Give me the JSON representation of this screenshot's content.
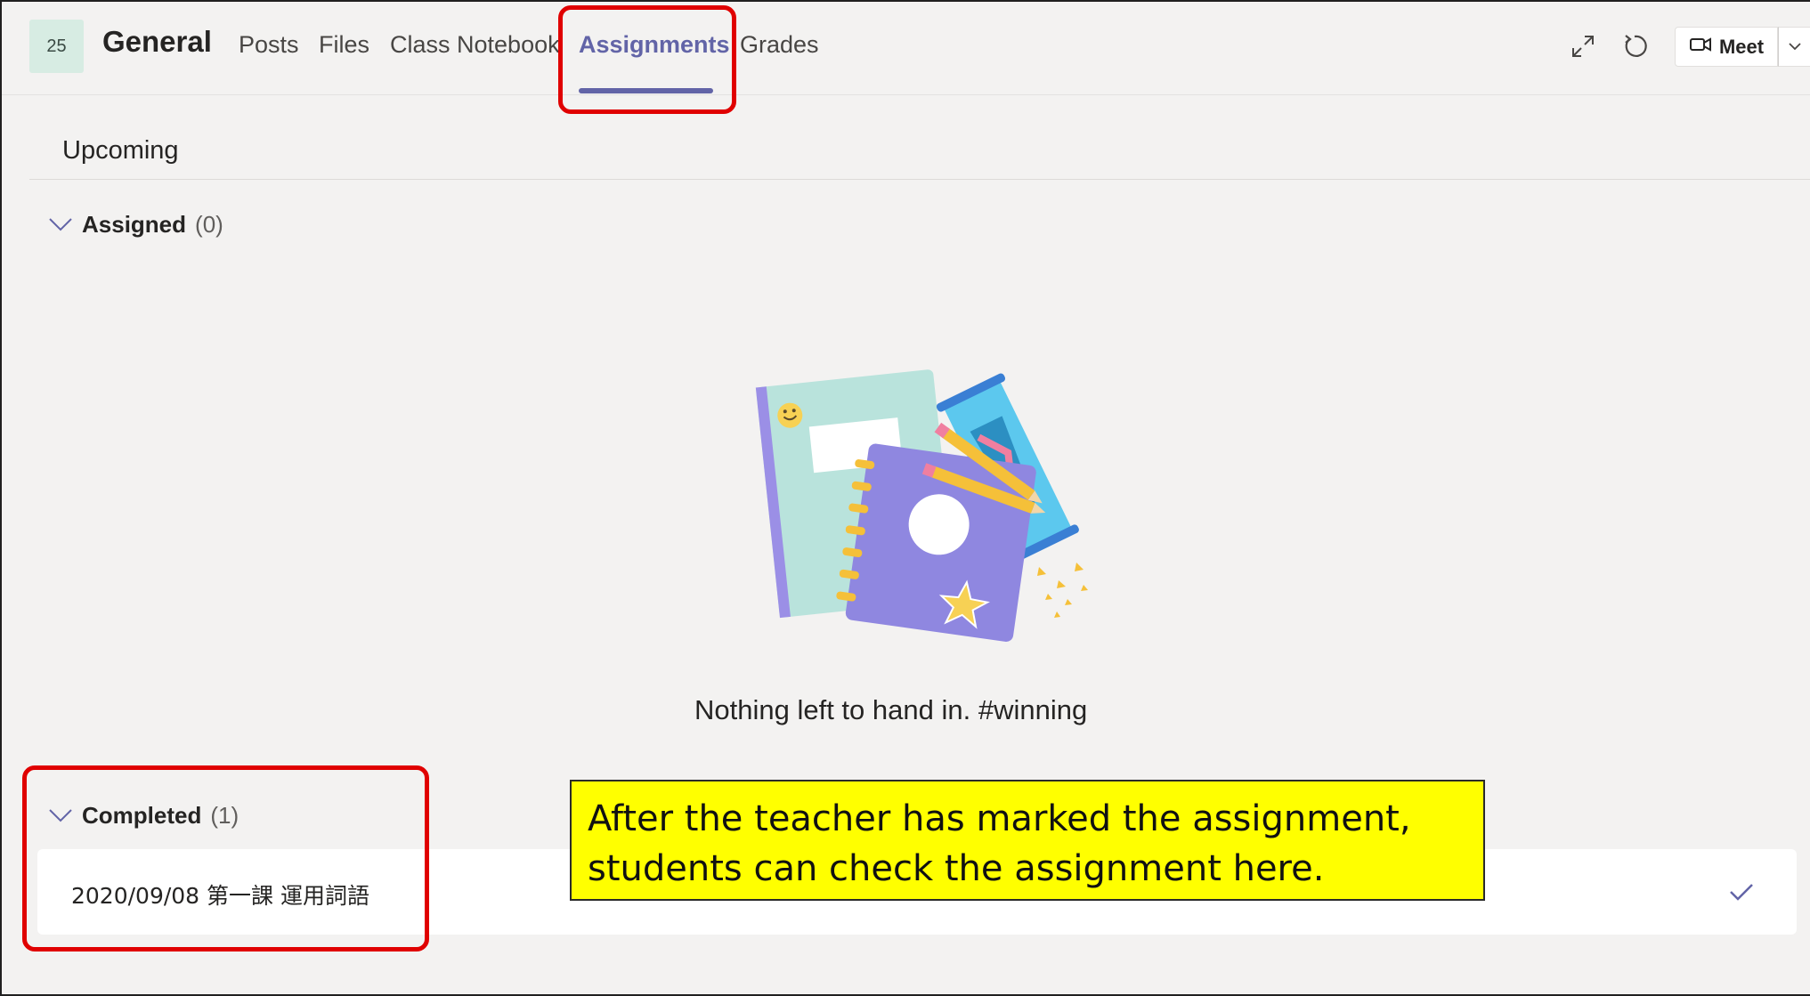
{
  "header": {
    "team_badge": "25",
    "channel_title": "General",
    "tabs": [
      {
        "label": "Posts"
      },
      {
        "label": "Files"
      },
      {
        "label": "Class Notebook"
      },
      {
        "label": "Assignments",
        "active": true
      },
      {
        "label": "Grades"
      }
    ],
    "icons": [
      "expand-icon",
      "refresh-icon"
    ],
    "meet_label": "Meet"
  },
  "main": {
    "section_title": "Upcoming",
    "assigned": {
      "label": "Assigned",
      "count": "(0)"
    },
    "empty_message": "Nothing left to hand in. #winning",
    "completed": {
      "label": "Completed",
      "count": "(1)"
    },
    "completed_items": [
      {
        "title": "2020/09/08 第一課 運用詞語"
      }
    ]
  },
  "annotation": {
    "callout_text": "After the teacher has marked the assignment, students can check the assignment here."
  },
  "colors": {
    "accent": "#6264a7",
    "highlight_border": "#e00000",
    "callout_bg": "#ffff00",
    "background": "#f3f2f1"
  }
}
